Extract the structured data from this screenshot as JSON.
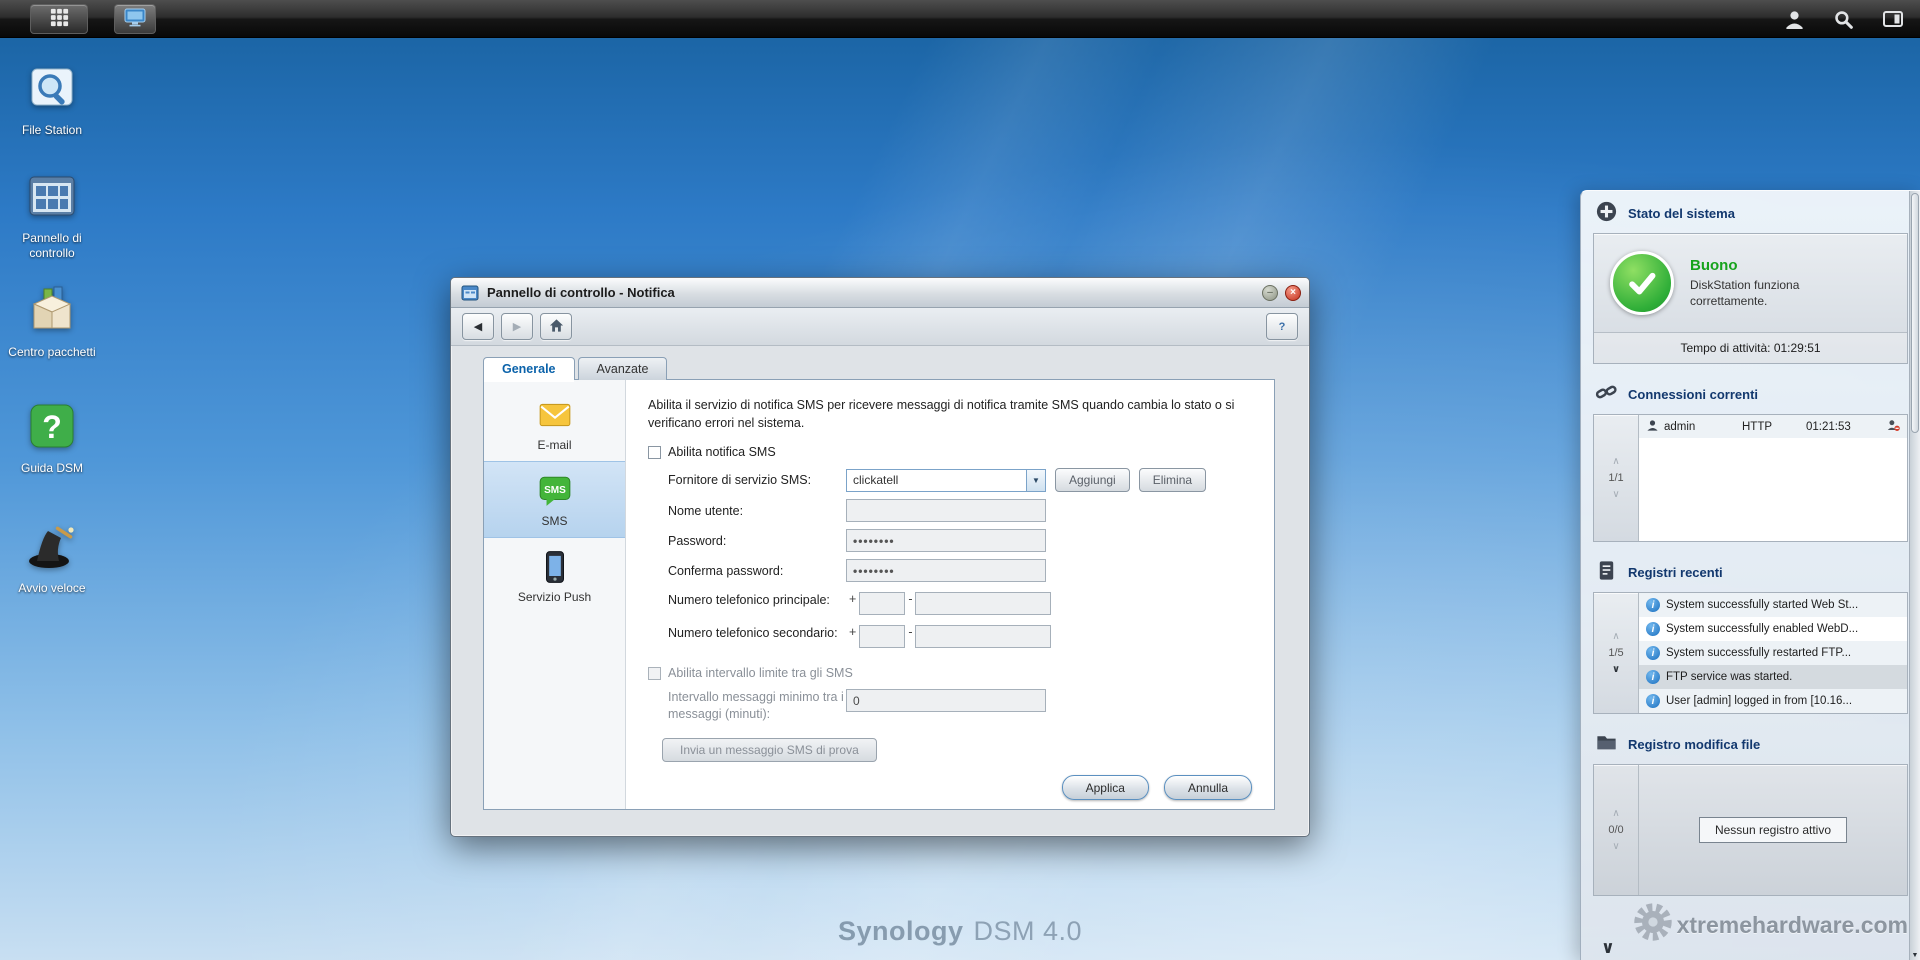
{
  "colors": {
    "status_ok": "#17a31d",
    "panel_header_text": "#12386e",
    "tab_active_text": "#0a62aa",
    "close_button_red": "#c5301c",
    "desktop_blue_top": "#18619f",
    "desktop_blue_bottom": "#c8dff2"
  },
  "glyphs": {
    "back": "◀",
    "forward": "▶",
    "help": "?",
    "pin": "–",
    "close": "×",
    "dropdown_arrow": "▼",
    "page_up": "∧",
    "page_down": "∨",
    "info": "i",
    "scroll_down": "▼"
  },
  "desktop": {
    "icons": [
      {
        "label": "File Station"
      },
      {
        "label": "Pannello di controllo"
      },
      {
        "label": "Centro pacchetti"
      },
      {
        "label": "Guida DSM"
      },
      {
        "label": "Avvio veloce"
      }
    ],
    "watermark_brand": "Synology",
    "watermark_version": "DSM 4.0",
    "site_watermark": "xtremehardware.com"
  },
  "window": {
    "title": "Pannello di controllo - Notifica",
    "tabs": [
      {
        "label": "Generale"
      },
      {
        "label": "Avanzate"
      }
    ],
    "sidebar": [
      {
        "label": "E-mail"
      },
      {
        "label": "SMS"
      },
      {
        "label": "Servizio Push"
      }
    ],
    "form": {
      "description": "Abilita il servizio di notifica SMS per ricevere messaggi di notifica tramite SMS quando cambia lo stato o si verificano errori nel sistema.",
      "enable_sms_label": "Abilita notifica SMS",
      "provider_label": "Fornitore di servizio SMS:",
      "provider_value": "clickatell",
      "add_button": "Aggiungi",
      "delete_button": "Elimina",
      "username_label": "Nome utente:",
      "username_value": "",
      "password_label": "Password:",
      "password_value": "••••••••",
      "confirm_password_label": "Conferma password:",
      "confirm_password_value": "••••••••",
      "primary_phone_label": "Numero telefonico principale:",
      "secondary_phone_label": "Numero telefonico secondario:",
      "phone_prefix": "+",
      "phone_separator": "-",
      "interval_enable_label": "Abilita intervallo limite tra gli SMS",
      "interval_label": "Intervallo messaggi minimo tra i messaggi (minuti):",
      "interval_value": "0",
      "test_button": "Invia un messaggio SMS di prova",
      "apply_button": "Applica",
      "cancel_button": "Annulla"
    }
  },
  "widgets": {
    "system_status": {
      "title": "Stato del sistema",
      "status": "Buono",
      "description": "DiskStation funziona correttamente.",
      "uptime": "Tempo di attività: 01:29:51"
    },
    "connections": {
      "title": "Connessioni correnti",
      "page": "1/1",
      "rows": [
        {
          "user": "admin",
          "protocol": "HTTP",
          "time": "01:21:53"
        }
      ]
    },
    "logs": {
      "title": "Registri recenti",
      "page": "1/5",
      "entries": [
        "System successfully started Web St...",
        "System successfully enabled WebD...",
        "System successfully restarted FTP...",
        "FTP service was started.",
        "User [admin] logged in from [10.16..."
      ]
    },
    "file_log": {
      "title": "Registro modifica file",
      "page": "0/0",
      "empty_text": "Nessun registro attivo"
    }
  }
}
